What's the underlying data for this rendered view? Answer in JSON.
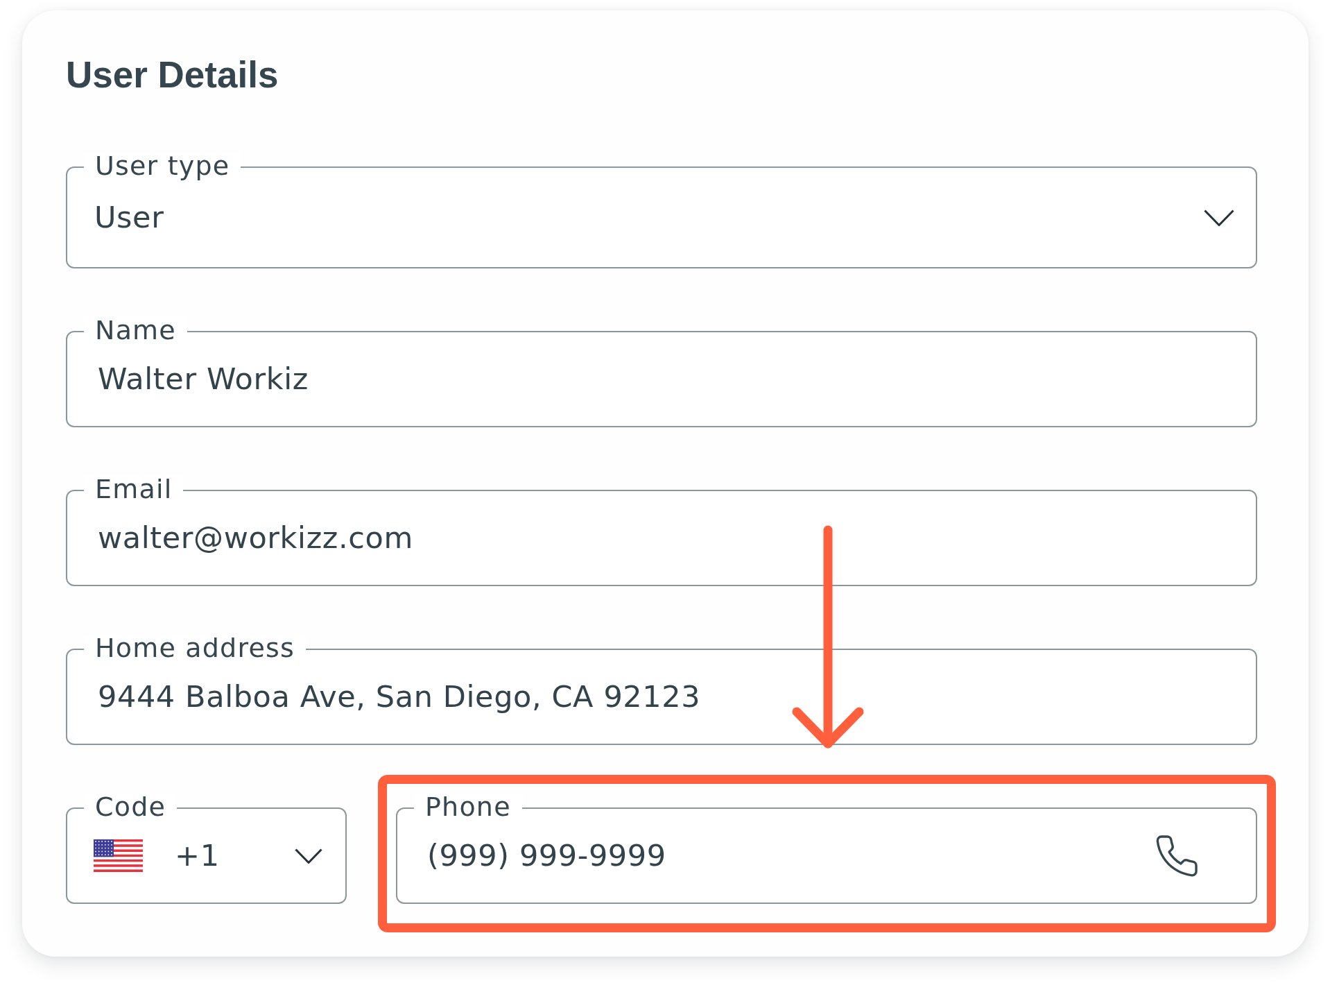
{
  "title": "User Details",
  "fields": [
    {
      "kind": "select",
      "label": "User type",
      "value": "User"
    },
    {
      "kind": "text",
      "label": "Name",
      "value": "Walter Workiz"
    },
    {
      "kind": "text",
      "label": "Email",
      "value": "walter@workizz.com"
    },
    {
      "kind": "text",
      "label": "Home address",
      "value": "9444 Balboa Ave, San Diego, CA 92123"
    }
  ],
  "contact_row": [
    {
      "kind": "code",
      "label": "Code",
      "value": "+1",
      "highlighted": false
    },
    {
      "kind": "phone",
      "label": "Phone",
      "value": "(999) 999-9999",
      "highlighted": true
    }
  ]
}
